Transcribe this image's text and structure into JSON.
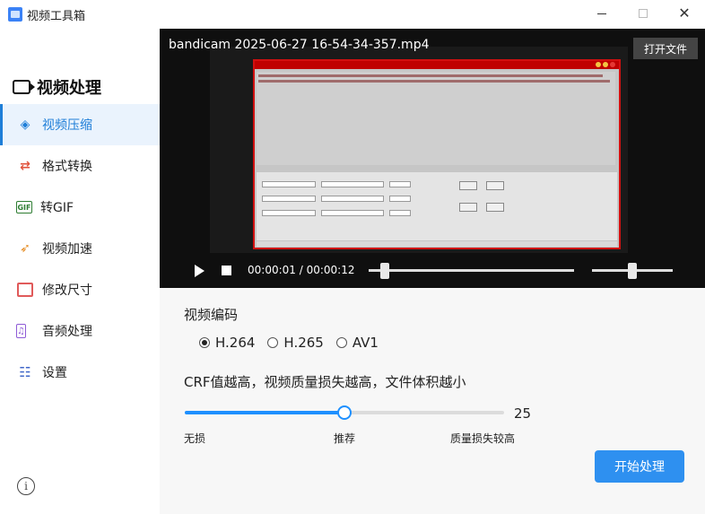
{
  "window": {
    "title": "视频工具箱",
    "close_glyph": "✕"
  },
  "sidebar": {
    "section_title": "视频处理",
    "items": [
      {
        "label": "视频压缩",
        "icon": "layers-icon",
        "glyph": "◈",
        "active": true
      },
      {
        "label": "格式转换",
        "icon": "swap-icon",
        "glyph": "⇄",
        "active": false
      },
      {
        "label": "转GIF",
        "icon": "gif-icon",
        "glyph": "GIF",
        "active": false
      },
      {
        "label": "视频加速",
        "icon": "rocket-icon",
        "glyph": "➶",
        "active": false
      },
      {
        "label": "修改尺寸",
        "icon": "resize-icon",
        "glyph": "",
        "active": false
      },
      {
        "label": "音频处理",
        "icon": "music-icon",
        "glyph": "♫",
        "active": false
      },
      {
        "label": "设置",
        "icon": "settings-icon",
        "glyph": "☷",
        "active": false
      }
    ],
    "info_glyph": "i"
  },
  "player": {
    "filename": "bandicam 2025-06-27 16-54-34-357.mp4",
    "open_button": "打开文件",
    "time_display": "00:00:01 / 00:00:12",
    "progress": 0.08,
    "volume": 0.5
  },
  "encoder": {
    "label": "视频编码",
    "options": [
      {
        "label": "H.264",
        "checked": true
      },
      {
        "label": "H.265",
        "checked": false
      },
      {
        "label": "AV1",
        "checked": false
      }
    ]
  },
  "crf": {
    "description": "CRF值越高，视频质量损失越高，文件体积越小",
    "value": "25",
    "min_label": "无损",
    "mid_label": "推荐",
    "max_label": "质量损失较高",
    "position": 0.5
  },
  "actions": {
    "start": "开始处理"
  },
  "colors": {
    "accent": "#1e7ed8",
    "button": "#2e90f0",
    "player_bg": "#0f0f0f"
  }
}
